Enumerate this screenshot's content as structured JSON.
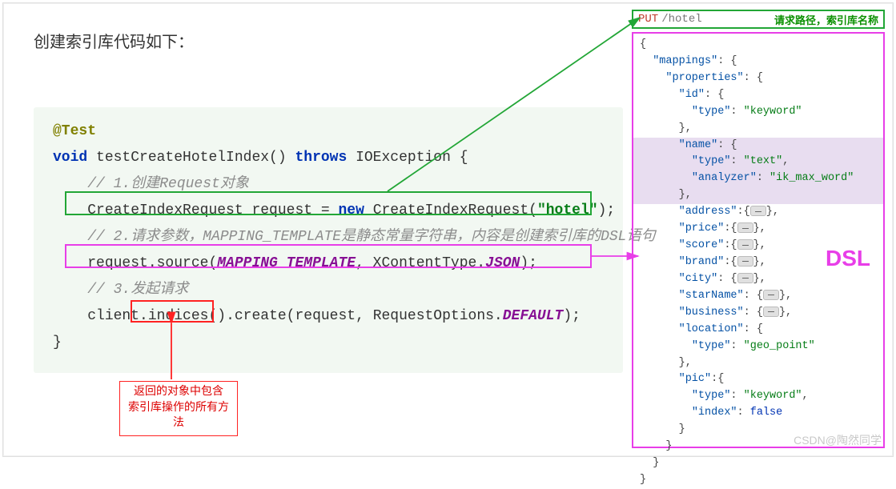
{
  "title": "创建索引库代码如下：",
  "code": {
    "ann": "@Test",
    "l1_void": "void",
    "l1_name": " testCreateHotelIndex() ",
    "l1_throws": "throws",
    "l1_exc": " IOException {",
    "c1": "// 1.创建Request对象",
    "l2_a": "CreateIndexRequest request = ",
    "l2_new": "new",
    "l2_b": " CreateIndexRequest(",
    "l2_str": "\"hotel\"",
    "l2_c": ");",
    "c2_a": "// 2.请求参数，MAPPING_TEMPLATE是静态常量字符串，内容是创建索引库的",
    "c2_b": "DSL",
    "c2_c": "语句",
    "l3_a": "request.source(",
    "l3_m": "MAPPING_TEMPLATE",
    "l3_b": ", XContentType.",
    "l3_j": "JSON",
    "l3_c": ");",
    "c3": "// 3.发起请求",
    "l4_a": "client.",
    "l4_i": "indices()",
    "l4_b": ".create(request, RequestOptions.",
    "l4_d": "DEFAULT",
    "l4_e": ");",
    "end": "}"
  },
  "note_red_line1": "返回的对象中包含",
  "note_red_line2": "索引库操作的所有方法",
  "put": "PUT",
  "request_path": "/hotel",
  "right_label": "请求路径，索引库名称",
  "dsl_label": "DSL",
  "json": {
    "b0": "{",
    "mappings": "\"mappings\"",
    "properties": "\"properties\"",
    "id": "\"id\"",
    "type": "\"type\"",
    "keyword": "\"keyword\"",
    "name": "\"name\"",
    "text": "\"text\"",
    "analyzer": "\"analyzer\"",
    "ik": "\"ik_max_word\"",
    "address": "\"address\"",
    "price": "\"price\"",
    "score": "\"score\"",
    "brand": "\"brand\"",
    "city": "\"city\"",
    "starName": "\"starName\"",
    "business": "\"business\"",
    "location": "\"location\"",
    "geo": "\"geo_point\"",
    "pic": "\"pic\"",
    "index": "\"index\"",
    "false": "false",
    "be": "}"
  },
  "watermark": "CSDN@陶然同学"
}
